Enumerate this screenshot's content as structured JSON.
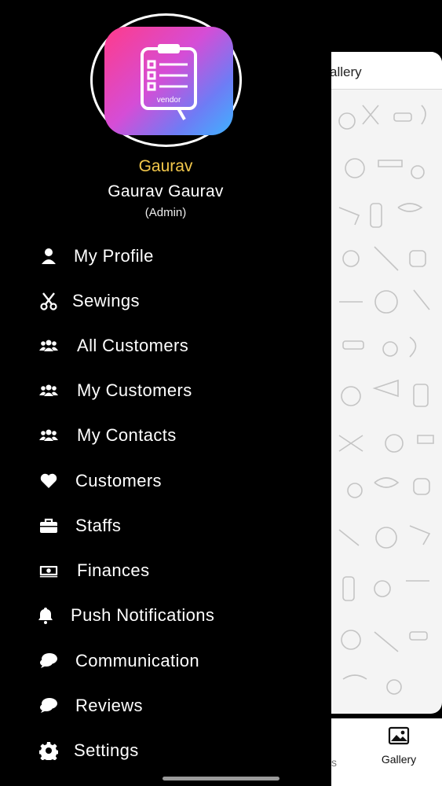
{
  "drawer": {
    "logo_text": "vendor",
    "username": "Gaurav",
    "full_name": "Gaurav Gaurav",
    "role": "(Admin)",
    "items": [
      {
        "label": "My Profile",
        "icon": "person-icon"
      },
      {
        "label": "Sewings",
        "icon": "scissors-icon"
      },
      {
        "label": "All Customers",
        "icon": "users-icon"
      },
      {
        "label": "My Customers",
        "icon": "users-icon"
      },
      {
        "label": "My Contacts",
        "icon": "users-icon"
      },
      {
        "label": "Customers",
        "icon": "heart-icon"
      },
      {
        "label": "Staffs",
        "icon": "briefcase-icon"
      },
      {
        "label": "Finances",
        "icon": "money-icon"
      },
      {
        "label": "Push Notifications",
        "icon": "bell-icon"
      },
      {
        "label": "Communication",
        "icon": "chat-icon"
      },
      {
        "label": "Reviews",
        "icon": "chat-icon"
      },
      {
        "label": "Settings",
        "icon": "gear-icon"
      }
    ]
  },
  "background_app": {
    "header_title_fragment": "allery",
    "bottom_tab_fragment": "s",
    "gallery_tab_label": "Gallery"
  },
  "colors": {
    "username": "#f3c84b",
    "drawer_bg": "#000000"
  }
}
